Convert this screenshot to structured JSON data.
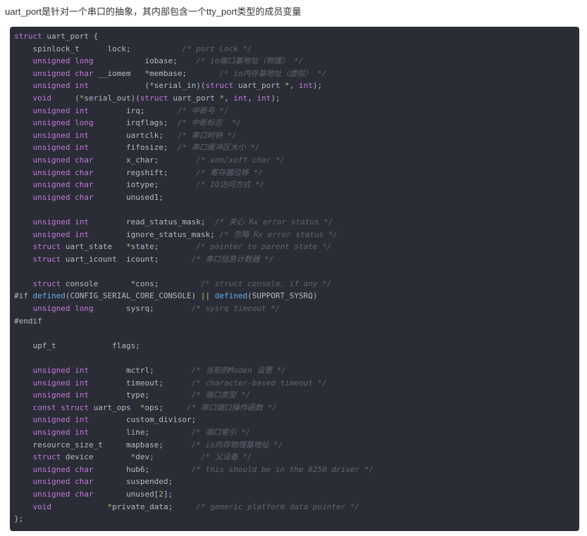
{
  "page": {
    "background": "#ffffff",
    "header_text": "uart_port是针对一个串口的抽象，其内部包含一个tty_port类型的成员变量"
  },
  "code_block": {
    "background": "#2a2d35",
    "colors": {
      "keyword": "#c678dd",
      "plain": "#b4bac6",
      "comment": "#5e6673",
      "green": "#98c379",
      "blue": "#61aeee"
    },
    "lines": [
      [
        [
          "k",
          "struct"
        ],
        [
          "p",
          " uart_port {"
        ]
      ],
      [
        [
          "p",
          "    spinlock_t      lock;           "
        ],
        [
          "c",
          "/* port Lock */"
        ]
      ],
      [
        [
          "p",
          "    "
        ],
        [
          "k",
          "unsigned long"
        ],
        [
          "p",
          "           iobase;    "
        ],
        [
          "c",
          "/* io端口基地址（物理） */"
        ]
      ],
      [
        [
          "p",
          "    "
        ],
        [
          "k",
          "unsigned char"
        ],
        [
          "p",
          " __iomem   "
        ],
        [
          "g",
          "*"
        ],
        [
          "p",
          "membase;       "
        ],
        [
          "c",
          "/* io内存基地址（虚拟） */"
        ]
      ],
      [
        [
          "p",
          "    "
        ],
        [
          "k",
          "unsigned int"
        ],
        [
          "p",
          "            ("
        ],
        [
          "g",
          "*"
        ],
        [
          "p",
          "serial_in)("
        ],
        [
          "k",
          "struct"
        ],
        [
          "p",
          " uart_port "
        ],
        [
          "g",
          "*"
        ],
        [
          "p",
          ", "
        ],
        [
          "k",
          "int"
        ],
        [
          "p",
          ");"
        ]
      ],
      [
        [
          "p",
          "    "
        ],
        [
          "k",
          "void"
        ],
        [
          "p",
          "     ("
        ],
        [
          "g",
          "*"
        ],
        [
          "p",
          "serial_out)("
        ],
        [
          "k",
          "struct"
        ],
        [
          "p",
          " uart_port "
        ],
        [
          "g",
          "*"
        ],
        [
          "p",
          ", "
        ],
        [
          "k",
          "int"
        ],
        [
          "p",
          ", "
        ],
        [
          "k",
          "int"
        ],
        [
          "p",
          ");"
        ]
      ],
      [
        [
          "p",
          "    "
        ],
        [
          "k",
          "unsigned int"
        ],
        [
          "p",
          "        irq;       "
        ],
        [
          "c",
          "/* 中断号 */"
        ]
      ],
      [
        [
          "p",
          "    "
        ],
        [
          "k",
          "unsigned long"
        ],
        [
          "p",
          "       irqflags;  "
        ],
        [
          "c",
          "/* 中断标志  */"
        ]
      ],
      [
        [
          "p",
          "    "
        ],
        [
          "k",
          "unsigned int"
        ],
        [
          "p",
          "        uartclk;   "
        ],
        [
          "c",
          "/* 串口时钟 */"
        ]
      ],
      [
        [
          "p",
          "    "
        ],
        [
          "k",
          "unsigned int"
        ],
        [
          "p",
          "        fifosize;  "
        ],
        [
          "c",
          "/* 串口缓冲区大小 */"
        ]
      ],
      [
        [
          "p",
          "    "
        ],
        [
          "k",
          "unsigned char"
        ],
        [
          "p",
          "       x_char;        "
        ],
        [
          "c",
          "/* xon/xoff char */"
        ]
      ],
      [
        [
          "p",
          "    "
        ],
        [
          "k",
          "unsigned char"
        ],
        [
          "p",
          "       regshift;      "
        ],
        [
          "c",
          "/* 寄存器位移 */"
        ]
      ],
      [
        [
          "p",
          "    "
        ],
        [
          "k",
          "unsigned char"
        ],
        [
          "p",
          "       iotype;        "
        ],
        [
          "c",
          "/* IO访问方式 */"
        ]
      ],
      [
        [
          "p",
          "    "
        ],
        [
          "k",
          "unsigned char"
        ],
        [
          "p",
          "       unused1;"
        ]
      ],
      [],
      [
        [
          "p",
          "    "
        ],
        [
          "k",
          "unsigned int"
        ],
        [
          "p",
          "        read_status_mask;  "
        ],
        [
          "c",
          "/* 关心 Rx error status */"
        ]
      ],
      [
        [
          "p",
          "    "
        ],
        [
          "k",
          "unsigned int"
        ],
        [
          "p",
          "        ignore_status_mask; "
        ],
        [
          "c",
          "/* 忽略 Rx error status */"
        ]
      ],
      [
        [
          "p",
          "    "
        ],
        [
          "k",
          "struct"
        ],
        [
          "p",
          " uart_state   "
        ],
        [
          "g",
          "*"
        ],
        [
          "p",
          "state;        "
        ],
        [
          "c",
          "/* pointer to parent state */"
        ]
      ],
      [
        [
          "p",
          "    "
        ],
        [
          "k",
          "struct"
        ],
        [
          "p",
          " uart_icount  icount;       "
        ],
        [
          "c",
          "/* 串口信息计数器 */"
        ]
      ],
      [],
      [
        [
          "p",
          "    "
        ],
        [
          "k",
          "struct"
        ],
        [
          "p",
          " console       "
        ],
        [
          "g",
          "*"
        ],
        [
          "p",
          "cons;         "
        ],
        [
          "c",
          "/* struct console, if any */"
        ]
      ],
      [
        [
          "p",
          "#if "
        ],
        [
          "b",
          "defined"
        ],
        [
          "p",
          "(CONFIG_SERIAL_CORE_CONSOLE) "
        ],
        [
          "g",
          "||"
        ],
        [
          "p",
          " "
        ],
        [
          "b",
          "defined"
        ],
        [
          "p",
          "(SUPPORT_SYSRQ)"
        ]
      ],
      [
        [
          "p",
          "    "
        ],
        [
          "k",
          "unsigned long"
        ],
        [
          "p",
          "       sysrq;        "
        ],
        [
          "c",
          "/* sysrq timeout */"
        ]
      ],
      [
        [
          "p",
          "#endif"
        ]
      ],
      [],
      [
        [
          "p",
          "    upf_t            flags;"
        ]
      ],
      [],
      [
        [
          "p",
          "    "
        ],
        [
          "k",
          "unsigned int"
        ],
        [
          "p",
          "        mctrl;        "
        ],
        [
          "c",
          "/* 当前的Moden 设置 */"
        ]
      ],
      [
        [
          "p",
          "    "
        ],
        [
          "k",
          "unsigned int"
        ],
        [
          "p",
          "        timeout;      "
        ],
        [
          "c",
          "/* character-based timeout */"
        ]
      ],
      [
        [
          "p",
          "    "
        ],
        [
          "k",
          "unsigned int"
        ],
        [
          "p",
          "        type;         "
        ],
        [
          "c",
          "/* 端口类型 */"
        ]
      ],
      [
        [
          "p",
          "    "
        ],
        [
          "k",
          "const struct"
        ],
        [
          "p",
          " uart_ops  "
        ],
        [
          "g",
          "*"
        ],
        [
          "p",
          "ops;     "
        ],
        [
          "c",
          "/* 串口端口操作函数 */"
        ]
      ],
      [
        [
          "p",
          "    "
        ],
        [
          "k",
          "unsigned int"
        ],
        [
          "p",
          "        custom_divisor;"
        ]
      ],
      [
        [
          "p",
          "    "
        ],
        [
          "k",
          "unsigned int"
        ],
        [
          "p",
          "        line;         "
        ],
        [
          "c",
          "/* 端口索引 */"
        ]
      ],
      [
        [
          "p",
          "    resource_size_t     mapbase;      "
        ],
        [
          "c",
          "/* io内存物理基地址 */"
        ]
      ],
      [
        [
          "p",
          "    "
        ],
        [
          "k",
          "struct"
        ],
        [
          "p",
          " device        "
        ],
        [
          "g",
          "*"
        ],
        [
          "p",
          "dev;          "
        ],
        [
          "c",
          "/* 父设备 */"
        ]
      ],
      [
        [
          "p",
          "    "
        ],
        [
          "k",
          "unsigned char"
        ],
        [
          "p",
          "       hub6;         "
        ],
        [
          "c",
          "/* this should be in the 8250 driver */"
        ]
      ],
      [
        [
          "p",
          "    "
        ],
        [
          "k",
          "unsigned char"
        ],
        [
          "p",
          "       suspended;"
        ]
      ],
      [
        [
          "p",
          "    "
        ],
        [
          "k",
          "unsigned char"
        ],
        [
          "p",
          "       unused["
        ],
        [
          "g",
          "2"
        ],
        [
          "p",
          "];"
        ]
      ],
      [
        [
          "p",
          "    "
        ],
        [
          "k",
          "void"
        ],
        [
          "p",
          "            "
        ],
        [
          "g",
          "*"
        ],
        [
          "p",
          "private_data;     "
        ],
        [
          "c",
          "/* generic platform data pointer */"
        ]
      ],
      [
        [
          "p",
          "};"
        ]
      ]
    ]
  }
}
